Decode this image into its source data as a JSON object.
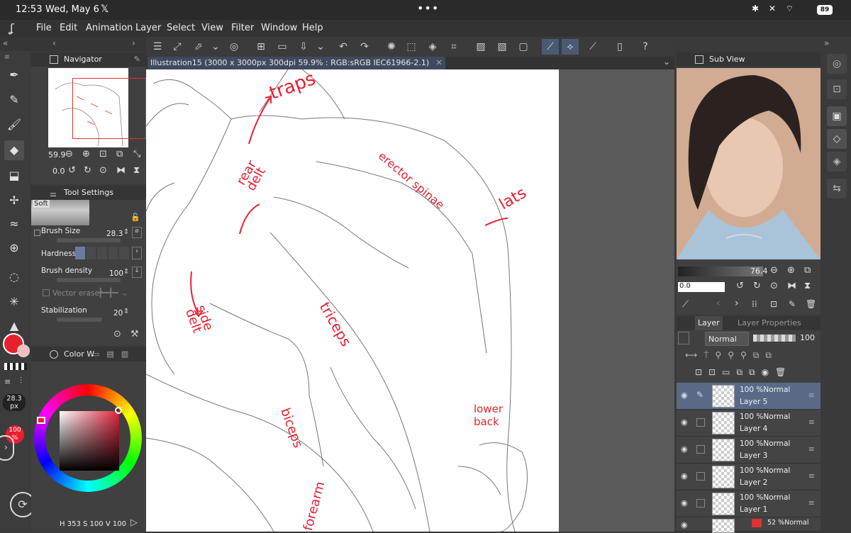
{
  "status": {
    "time": "12:53",
    "date": "Wed, May 6",
    "battery": "89"
  },
  "menu": [
    "File",
    "Edit",
    "Animation",
    "Layer",
    "Select",
    "View",
    "Filter",
    "Window",
    "Help"
  ],
  "navigator": {
    "title": "Navigator",
    "zoom": "59.9",
    "rotation": "0.0"
  },
  "tool_settings": {
    "title": "Tool Settings",
    "preset": "Soft",
    "brush_size_label": "Brush Size",
    "brush_size": "28.3",
    "hardness_label": "Hardness",
    "brush_density_label": "Brush density",
    "brush_density": "100",
    "vector_eraser_label": "Vector eraser",
    "stabilization_label": "Stabilization",
    "stabilization": "20"
  },
  "brush_indicator": {
    "size": "28.3",
    "unit": "px",
    "opacity": "100",
    "opacity_unit": "%"
  },
  "color_panel": {
    "title": "Color W",
    "hsv": {
      "h_label": "H",
      "h": "353",
      "s_label": "S",
      "s": "100",
      "v_label": "V",
      "v": "100"
    },
    "main_color": "#e8202e"
  },
  "document_tab": "Illustration15 (3000 x 3000px 300dpi 59.9% : RGB:sRGB IEC61966-2.1)",
  "canvas_annotations": [
    "traps",
    "erector spinae",
    "rear delt",
    "lats",
    "side delt",
    "triceps",
    "biceps",
    "lower back",
    "forearm"
  ],
  "subview": {
    "title": "Sub View",
    "zoom": "76.4",
    "rotation": "0.0"
  },
  "layer_panel": {
    "tab_layer": "Layer",
    "tab_properties": "Layer Properties",
    "blend_mode": "Normal",
    "opacity": "100",
    "layers": [
      {
        "mode": "100 %Normal",
        "name": "Layer 5",
        "selected": true
      },
      {
        "mode": "100 %Normal",
        "name": "Layer 4",
        "selected": false
      },
      {
        "mode": "100 %Normal",
        "name": "Layer 3",
        "selected": false
      },
      {
        "mode": "100 %Normal",
        "name": "Layer 2",
        "selected": false
      },
      {
        "mode": "100 %Normal",
        "name": "Layer 1",
        "selected": false
      }
    ],
    "ref_layer_mode": "52 %Normal"
  }
}
